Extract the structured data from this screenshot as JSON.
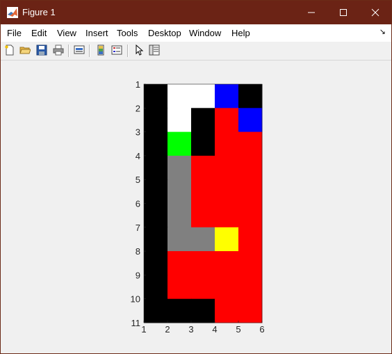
{
  "window": {
    "title": "Figure 1"
  },
  "menu": [
    "File",
    "Edit",
    "View",
    "Insert",
    "Tools",
    "Desktop",
    "Window",
    "Help"
  ],
  "toolbar": [
    "new-figure",
    "open-file",
    "save",
    "print",
    "link-plot",
    "insert-colorbar",
    "insert-legend",
    "edit-plot",
    "property-inspector"
  ],
  "axes": {
    "xticks": [
      "1",
      "2",
      "3",
      "4",
      "5",
      "6"
    ],
    "yticks": [
      "1",
      "2",
      "3",
      "4",
      "5",
      "6",
      "7",
      "8",
      "9",
      "10",
      "11"
    ],
    "xlim": [
      1,
      6
    ],
    "ylim": [
      1,
      11
    ],
    "ydir": "reverse",
    "grid": false
  },
  "colors": {
    "black": "#000000",
    "white": "#ffffff",
    "blue": "#0000ff",
    "red": "#ff0000",
    "green": "#00ff00",
    "gray": "#808080",
    "yellow": "#ffff00"
  },
  "chart_data": {
    "type": "heatmap",
    "rows": [
      [
        "black",
        "white",
        "white",
        "blue",
        "black"
      ],
      [
        "black",
        "white",
        "black",
        "red",
        "blue"
      ],
      [
        "black",
        "green",
        "black",
        "red",
        "red"
      ],
      [
        "black",
        "gray",
        "red",
        "red",
        "red"
      ],
      [
        "black",
        "gray",
        "red",
        "red",
        "red"
      ],
      [
        "black",
        "gray",
        "red",
        "red",
        "red"
      ],
      [
        "black",
        "gray",
        "gray",
        "yellow",
        "red"
      ],
      [
        "black",
        "red",
        "red",
        "red",
        "red"
      ],
      [
        "black",
        "red",
        "red",
        "red",
        "red"
      ],
      [
        "black",
        "black",
        "black",
        "red",
        "red"
      ]
    ]
  }
}
